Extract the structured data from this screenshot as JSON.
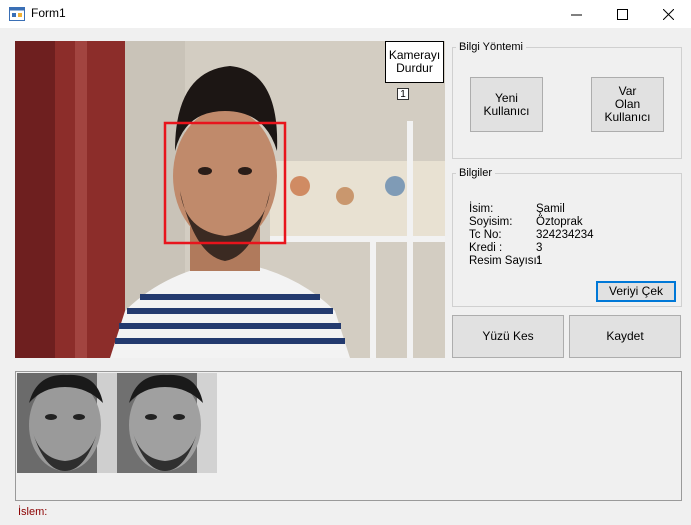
{
  "window": {
    "title": "Form1"
  },
  "camera": {
    "stop_label": "Kamerayı\nDurdur",
    "face_count": "1"
  },
  "method": {
    "group_label": "Bilgi Yöntemi",
    "new_user_label": "Yeni\nKullanıcı",
    "existing_user_label": "Var\nOlan\nKullanıcı"
  },
  "info": {
    "group_label": "Bilgiler",
    "rows": [
      {
        "label": "İsim:",
        "value": "Şamil"
      },
      {
        "label": "Soyisim:",
        "value": "Öztoprak"
      },
      {
        "label": "Tc No:",
        "value": "324234234"
      },
      {
        "label": "Kredi :",
        "value": "3"
      },
      {
        "label": "Resim Sayısı:",
        "value": "1"
      }
    ],
    "fetch_label": "Veriyi Çek"
  },
  "actions": {
    "crop_label": "Yüzü Kes",
    "save_label": "Kaydet"
  },
  "status": {
    "label": "İslem:",
    "value": ""
  },
  "colors": {
    "face_box": "#e8141c",
    "status_text": "#8b0000",
    "focus_border": "#0078d7"
  }
}
